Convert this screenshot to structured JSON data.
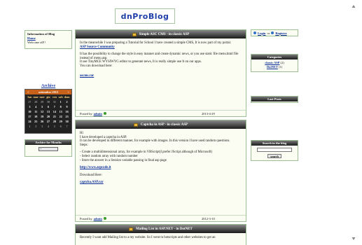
{
  "site": {
    "logo": "dnProBlog"
  },
  "info": {
    "title": "Information of Blog",
    "home_link": "Home",
    "welcome": "Welcome all!!"
  },
  "archive": {
    "title": "Archive",
    "month": "settembre 2012",
    "prev": "<",
    "next": ">",
    "weekdays": [
      "lun",
      "mar",
      "mer",
      "gio",
      "ven",
      "sab",
      "dom"
    ],
    "days": [
      "27",
      "28",
      "29",
      "30",
      "31",
      "1",
      "2",
      "3",
      "4",
      "5",
      "6",
      "7",
      "8",
      "9",
      "10",
      "11",
      "12",
      "13",
      "14",
      "15",
      "16",
      "17",
      "18",
      "19",
      "20",
      "21",
      "22",
      "23",
      "24",
      "25",
      "26",
      "27",
      "28",
      "29",
      "30",
      "1",
      "2",
      "3",
      "4",
      "5",
      "6",
      "7"
    ],
    "months_title": "Archive for Months",
    "months_selected": "--"
  },
  "posts": [
    {
      "title": "Simple ASC CMS - in classic ASP",
      "p1": "In the meanwhile I was preparing a Tutorial for School I have created a simple CMS, It is now part of my portal.",
      "link1": "ASP Source Community",
      "p2": "It has the possibility to change the style in easy manner and create dynamic news, or you use static file menu.html file instead of menu.asp.",
      "p3": "It use TinyMCE WYSIWYG editor to generate news, It is really simple use It on our apps.",
      "p4": "You can download here:",
      "link2": "ascms.rar",
      "posted_by": "Posted by",
      "author": "admin",
      "date": "2013-4-29"
    },
    {
      "title": "Captcha in ASP - in classic ASP",
      "p1": "Hi",
      "p2": "I have developed a captcha in ASP.",
      "p3": "It can be developed in different manner, for example with images. In this version I have used random questions.",
      "p4": "Steps:",
      "step1": "- Create a multidimensional array, for example in VBScript(I prefer JScript although of Microsoft)",
      "step2": "- Select random array with random number",
      "step3": "- Store the answer in a Session variable passing in final asp page",
      "link1": "http://www.aspcode.it",
      "p5": "Download Here:",
      "link2": "captcha.ASP.rar",
      "posted_by": "Posted by",
      "author": "admin",
      "date": "2012-3-10"
    },
    {
      "title": "Mailing List in ASP.NET - in DotNET",
      "p1": "Recently I want add Mailing list to a my website. So I went to hotscripts and other websites to get an"
    }
  ],
  "login": {
    "login": "Login",
    "or": "or",
    "register": "Register"
  },
  "categories": {
    "title": "Categories",
    "items": [
      {
        "name": "classic ASP",
        "count": "(2)"
      },
      {
        "name": "DotNET",
        "count": "(1)"
      }
    ]
  },
  "last_posts": {
    "title": "Last Posts"
  },
  "search": {
    "title": "Search in the blog",
    "button": "search"
  }
}
